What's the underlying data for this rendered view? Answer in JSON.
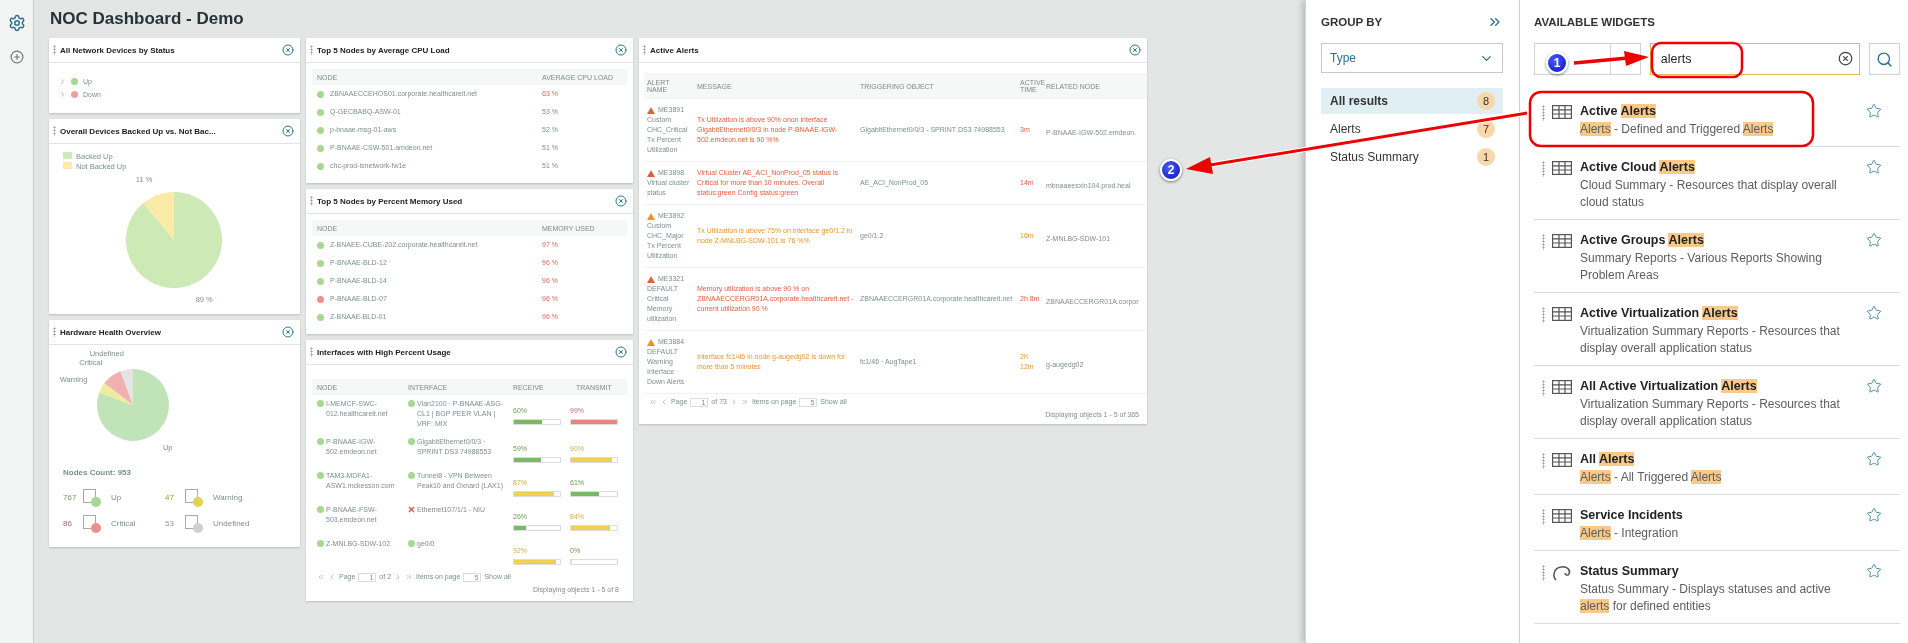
{
  "dashboard": {
    "title": "NOC Dashboard - Demo",
    "columns": [
      [
        {
          "kind": "status_tree",
          "title": "All Network Devices by Status",
          "items": [
            {
              "label": "Up",
              "color": "#a6d98f",
              "expanded": false
            },
            {
              "label": "Down",
              "color": "#ee9f9f",
              "expanded": false
            }
          ]
        },
        {
          "kind": "pie",
          "title": "Overall Devices Backed Up vs. Not Bac...",
          "chart_data": {
            "type": "pie",
            "categories": [
              "Backed Up",
              "Not Backed Up"
            ],
            "values": [
              89,
              11
            ],
            "value_labels": [
              "89 %",
              "11 %"
            ],
            "legend": "top-left"
          }
        },
        {
          "kind": "hardware",
          "title": "Hardware Health Overview",
          "chart_data": {
            "type": "pie",
            "categories": [
              "Up",
              "Warning",
              "Critical",
              "Undefined"
            ],
            "values": [
              80.5,
              4.9,
              9.0,
              5.6
            ]
          },
          "total": "Nodes Count: 953",
          "legend": [
            {
              "count": "767",
              "label": "Up",
              "color": "#a6d98f"
            },
            {
              "count": "47",
              "label": "Warning",
              "color": "#e3d24f"
            },
            {
              "count": "86",
              "label": "Critical",
              "color": "#ee8f8f"
            },
            {
              "count": "53",
              "label": "Undefined",
              "color": "#cfcfcf"
            }
          ]
        }
      ],
      [
        {
          "kind": "top_nodes",
          "title": "Top 5 Nodes by Average CPU Load",
          "columns": [
            "NODE",
            "AVERAGE CPU LOAD"
          ],
          "rows": [
            {
              "node": "ZBNAAECCEHOS01.corporate.healthcareit.net",
              "value": "63 %",
              "color": "#a6d98f",
              "critical": true
            },
            {
              "node": "Q-GECBABQ-ASW-01",
              "value": "53 %",
              "color": "#a6d98f",
              "critical": false
            },
            {
              "node": "p-bnaae-msg-01-aws",
              "value": "52 %",
              "color": "#a6d98f",
              "critical": false
            },
            {
              "node": "P-BNAAE-CSW-501.amdeon.net",
              "value": "51 %",
              "color": "#a6d98f",
              "critical": false
            },
            {
              "node": "chc-prod-isnetwork-fw1e",
              "value": "51 %",
              "color": "#a6d98f",
              "critical": false
            }
          ]
        },
        {
          "kind": "top_nodes",
          "title": "Top 5 Nodes by Percent Memory Used",
          "columns": [
            "NODE",
            "MEMORY USED"
          ],
          "rows": [
            {
              "node": "Z-BNAEE-CUBE-202.corporate.healthcareit.net",
              "value": "97 %",
              "color": "#a6d98f",
              "critical": true
            },
            {
              "node": "P-BNAAE-BLD-12",
              "value": "96 %",
              "color": "#a6d98f",
              "critical": true
            },
            {
              "node": "P-BNAAE-BLD-14",
              "value": "96 %",
              "color": "#a6d98f",
              "critical": true
            },
            {
              "node": "P-BNAAE-BLD-07",
              "value": "96 %",
              "color": "#ee8f8f",
              "critical": true
            },
            {
              "node": "Z-BNAAE-BLD-01",
              "value": "96 %",
              "color": "#a6d98f",
              "critical": true
            }
          ]
        },
        {
          "kind": "interfaces",
          "title": "Interfaces with High Percent Usage",
          "columns": [
            "NODE",
            "INTERFACE",
            "RECEIVE",
            "TRANSMIT"
          ],
          "rows": [
            {
              "node": "I-MEMCF-SWC-012.healthcareit.net",
              "color": "#a6d98f",
              "interface": "Vlan2100 · P-BNAAE-ASG-CL1 | BGP PEER VLAN | VRF: MIX",
              "interface_failed": false,
              "receive": {
                "reading": "60%",
                "level": 0.6
              },
              "transmit": {
                "reading": "99%",
                "level": 0.99
              }
            },
            {
              "node": "P-BNAAE-IGW-502.emdeon.net",
              "color": "#a6d98f",
              "interface": "GigabitEthernet0/0/3 · SPRINT DS3 74988553",
              "interface_failed": false,
              "receive": {
                "reading": "59%",
                "level": 0.59
              },
              "transmit": {
                "reading": "90%",
                "level": 0.9
              }
            },
            {
              "node": "TAM3-MDFA1-ASW1.mckesson.com",
              "color": "#a6d98f",
              "interface": "Tunnel8 - VPN Between Peak10 and Oxnard (LAX1)",
              "interface_failed": false,
              "receive": {
                "reading": "87%",
                "level": 0.87
              },
              "transmit": {
                "reading": "61%",
                "level": 0.61
              }
            },
            {
              "node": "P-BNAAE-FSW-503.emdeon.net",
              "color": "#a6d98f",
              "interface": "Ethernet107/1/1 - NIU",
              "interface_failed": true,
              "receive": {
                "reading": "26%",
                "level": 0.26
              },
              "transmit": {
                "reading": "84%",
                "level": 0.84
              }
            },
            {
              "node": "Z-MNLBG-SDW-102",
              "color": "#a6d98f",
              "interface": "ge0/0",
              "interface_failed": false,
              "receive": {
                "reading": "92%",
                "level": 0.92
              },
              "transmit": {
                "reading": "0%",
                "level": 0
              }
            }
          ],
          "pager": {
            "page_label": "Page",
            "page": "1",
            "of": "of 2",
            "items_label": "Items on page",
            "items": "5",
            "show_all": "Show all",
            "summary": "Displaying objects 1 - 5 of 8"
          }
        }
      ],
      [
        {
          "kind": "alerts",
          "title": "Active Alerts",
          "columns": [
            "ALERT NAME",
            "MESSAGE",
            "TRIGGERING OBJECT",
            "ACTIVE TIME",
            "RELATED NODE"
          ],
          "rows": [
            {
              "color": "#e0603f",
              "id": "ME3891",
              "name": "Custom CHC_Critical Tx Percent Utilization",
              "message": "Tx Utilization is above 90% onon interface GigabitEthernet0/0/3 in node P-BNAAE-IGW-502.emdeon.net is 90 %%",
              "object": "GigabitEthernet0/0/3 - SPRINT DS3 74988553",
              "time": "3m",
              "node": "P-BNAAE-IGW-502.emdeon."
            },
            {
              "color": "#e0603f",
              "id": "ME3898",
              "name": "Virtual cluster status",
              "message": "Virtual Cluster AE_ACI_NonProd_05 status is Critical for more than 10 minutes. Overall status:green Config status:green",
              "object": "AE_ACI_NonProd_05",
              "time": "14m",
              "node": "mbnaaeesxin104.prod.heal"
            },
            {
              "color": "#e8962a",
              "id": "ME3892",
              "name": "Custom CHC_Major Tx Percent Utilization",
              "message": "Tx Utilization is above 75% on interface ge0/1.2 in node Z-MNLBG-SDW-101 is 76 %%",
              "object": "ge0/1.2",
              "time": "16m",
              "node": "Z-MNLBG-SDW-101"
            },
            {
              "color": "#e0603f",
              "id": "ME3321",
              "name": "DEFAULT Critical Memory utilization",
              "message": "Memory utilization is above 90 % on ZBNAAECCERGR01A.corporate.healthcareit.net - current utilization 90 %",
              "object": "ZBNAAECCERGR01A.corporate.healthcareit.net",
              "time": "2h 8m",
              "node": "ZBNAAECCERGR01A.corpor"
            },
            {
              "color": "#e8962a",
              "id": "ME3884",
              "name": "DEFAULT Warning Interface Down Alerts",
              "message": "Interface fc1/46 in node g-augedg02 is down for more than 5 minutes",
              "object": "fc1/46 · AugTape1",
              "time": "2h 12m",
              "node": "g-augedg02"
            }
          ],
          "pager": {
            "page_label": "Page",
            "page": "1",
            "of": "of 73",
            "items_label": "Items on page",
            "items": "5",
            "show_all": "Show all",
            "summary": "Displaying objects 1 - 5 of 365"
          }
        }
      ]
    ]
  },
  "group_by": {
    "title": "GROUP BY",
    "select": "Type",
    "items": [
      {
        "label": "All results",
        "count": "8",
        "selected": true
      },
      {
        "label": "Alerts",
        "count": "7",
        "selected": false
      },
      {
        "label": "Status Summary",
        "count": "1",
        "selected": false
      }
    ]
  },
  "widgets": {
    "title": "AVAILABLE WIDGETS",
    "search": "alerts",
    "items": [
      {
        "kind": "table",
        "title": [
          {
            "text": "Active ",
            "highlight": false
          },
          {
            "text": "Alerts",
            "highlight": true
          }
        ],
        "description": [
          {
            "text": "Alerts",
            "highlight": true
          },
          {
            "text": " - Defined and Triggered ",
            "highlight": false
          },
          {
            "text": "Alerts",
            "highlight": true
          }
        ]
      },
      {
        "kind": "table",
        "title": [
          {
            "text": "Active Cloud ",
            "highlight": false
          },
          {
            "text": "Alerts",
            "highlight": true
          }
        ],
        "description": [
          {
            "text": "Cloud Summary - Resources that display overall cloud status",
            "highlight": false
          }
        ]
      },
      {
        "kind": "table",
        "title": [
          {
            "text": "Active Groups ",
            "highlight": false
          },
          {
            "text": "Alerts",
            "highlight": true
          }
        ],
        "description": [
          {
            "text": "Summary Reports - Various Reports Showing Problem Areas",
            "highlight": false
          }
        ]
      },
      {
        "kind": "table",
        "title": [
          {
            "text": "Active Virtualization ",
            "highlight": false
          },
          {
            "text": "Alerts",
            "highlight": true
          }
        ],
        "description": [
          {
            "text": "Virtualization Summary Reports - Resources that display overall application status",
            "highlight": false
          }
        ]
      },
      {
        "kind": "table",
        "title": [
          {
            "text": "All Active Virtualization ",
            "highlight": false
          },
          {
            "text": "Alerts",
            "highlight": true
          }
        ],
        "description": [
          {
            "text": "Virtualization Summary Reports - Resources that display overall application status",
            "highlight": false
          }
        ]
      },
      {
        "kind": "table",
        "title": [
          {
            "text": "All ",
            "highlight": false
          },
          {
            "text": "Alerts",
            "highlight": true
          }
        ],
        "description": [
          {
            "text": "Alerts",
            "highlight": true
          },
          {
            "text": " - All Triggered ",
            "highlight": false
          },
          {
            "text": "Alerts",
            "highlight": true
          }
        ]
      },
      {
        "kind": "table",
        "title": [
          {
            "text": "Service Incidents",
            "highlight": false
          }
        ],
        "description": [
          {
            "text": "Alerts",
            "highlight": true
          },
          {
            "text": " - Integration",
            "highlight": false
          }
        ]
      },
      {
        "kind": "gauge",
        "title": [
          {
            "text": "Status Summary",
            "highlight": false
          }
        ],
        "description": [
          {
            "text": "Status Summary - Displays statuses and active ",
            "highlight": false
          },
          {
            "text": "alerts",
            "highlight": true
          },
          {
            "text": " for defined entities",
            "highlight": false
          }
        ]
      }
    ]
  },
  "annotations": [
    {
      "kind": "badge",
      "label": "1"
    },
    {
      "kind": "badge",
      "label": "2"
    }
  ]
}
